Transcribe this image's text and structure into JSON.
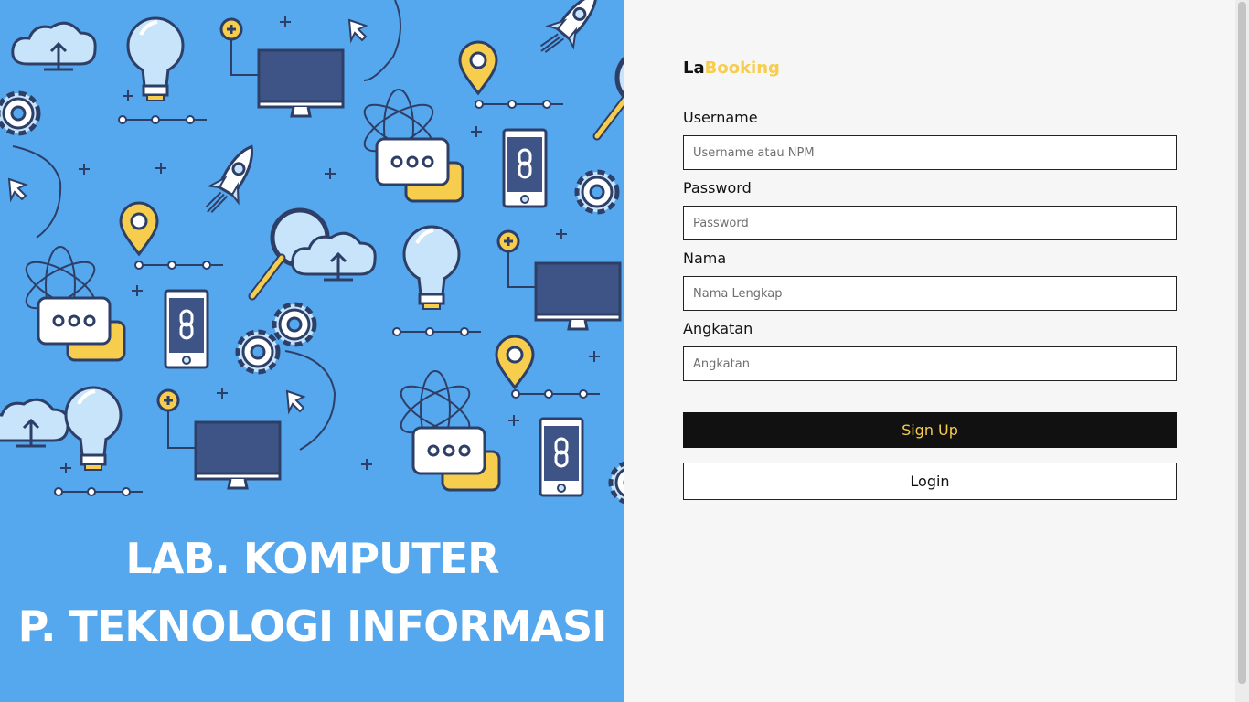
{
  "hero": {
    "line1": "LAB. KOMPUTER",
    "line2": "P. TEKNOLOGI INFORMASI",
    "background_color": "#55a7ee",
    "icons": [
      "cloud-upload-icon",
      "lightbulb-icon",
      "monitor-icon",
      "cursor-icon",
      "location-pin-icon",
      "rocket-icon",
      "gear-icon",
      "atom-icon",
      "chat-bubble-icon",
      "smartphone-link-icon",
      "magnifier-icon",
      "plus-icon"
    ]
  },
  "brand": {
    "prefix": "La",
    "suffix": "Booking",
    "accent_color": "#f6cd4c"
  },
  "form": {
    "username": {
      "label": "Username",
      "placeholder": "Username atau NPM",
      "value": ""
    },
    "password": {
      "label": "Password",
      "placeholder": "Password",
      "value": ""
    },
    "nama": {
      "label": "Nama",
      "placeholder": "Nama Lengkap",
      "value": ""
    },
    "angkatan": {
      "label": "Angkatan",
      "placeholder": "Angkatan",
      "value": ""
    },
    "signup_label": "Sign Up",
    "login_label": "Login"
  }
}
